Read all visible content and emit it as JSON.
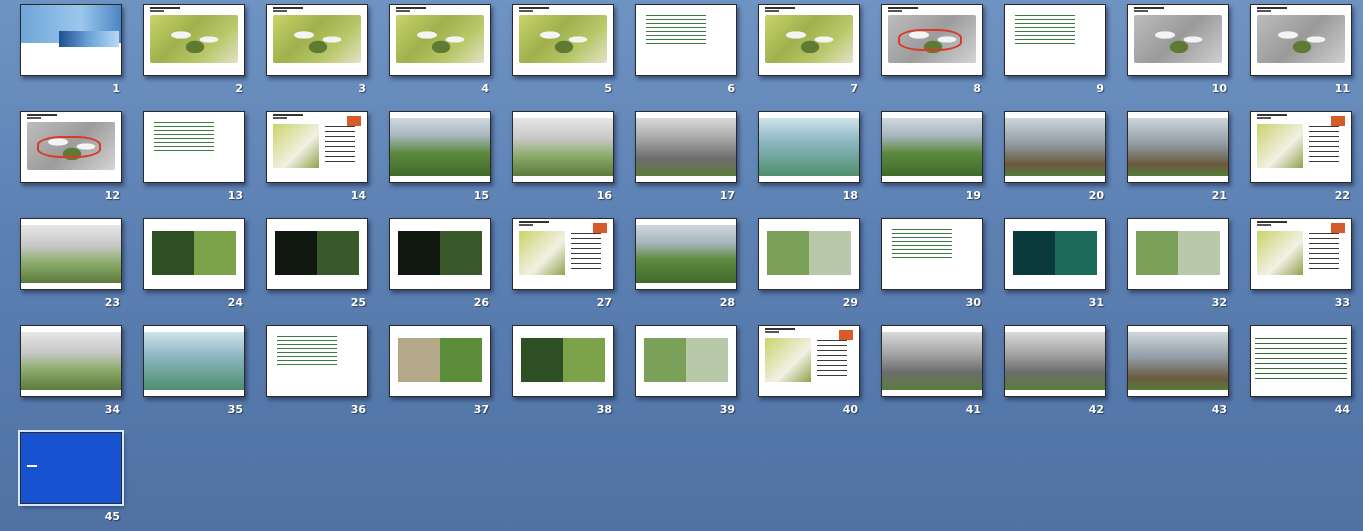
{
  "view": "slide-sorter",
  "slides": [
    {
      "n": "1",
      "kind": "cover"
    },
    {
      "n": "2",
      "kind": "plan"
    },
    {
      "n": "3",
      "kind": "plan"
    },
    {
      "n": "4",
      "kind": "plan"
    },
    {
      "n": "5",
      "kind": "plan"
    },
    {
      "n": "6",
      "kind": "text"
    },
    {
      "n": "7",
      "kind": "plan"
    },
    {
      "n": "8",
      "kind": "plan-red"
    },
    {
      "n": "9",
      "kind": "text"
    },
    {
      "n": "10",
      "kind": "plan-gray"
    },
    {
      "n": "11",
      "kind": "plan-gray"
    },
    {
      "n": "12",
      "kind": "plan-red"
    },
    {
      "n": "13",
      "kind": "text"
    },
    {
      "n": "14",
      "kind": "side"
    },
    {
      "n": "15",
      "kind": "photo"
    },
    {
      "n": "16",
      "kind": "photo-city"
    },
    {
      "n": "17",
      "kind": "photo-street"
    },
    {
      "n": "18",
      "kind": "photo-water"
    },
    {
      "n": "19",
      "kind": "photo"
    },
    {
      "n": "20",
      "kind": "photo-building"
    },
    {
      "n": "21",
      "kind": "photo-building"
    },
    {
      "n": "22",
      "kind": "side"
    },
    {
      "n": "23",
      "kind": "photo-city"
    },
    {
      "n": "24",
      "kind": "split"
    },
    {
      "n": "25",
      "kind": "split-night"
    },
    {
      "n": "26",
      "kind": "split-night"
    },
    {
      "n": "27",
      "kind": "side"
    },
    {
      "n": "28",
      "kind": "photo"
    },
    {
      "n": "29",
      "kind": "split-garden"
    },
    {
      "n": "30",
      "kind": "text"
    },
    {
      "n": "31",
      "kind": "split-aqua"
    },
    {
      "n": "32",
      "kind": "split-garden"
    },
    {
      "n": "33",
      "kind": "side"
    },
    {
      "n": "34",
      "kind": "photo-city"
    },
    {
      "n": "35",
      "kind": "photo-water"
    },
    {
      "n": "36",
      "kind": "text"
    },
    {
      "n": "37",
      "kind": "split-stair"
    },
    {
      "n": "38",
      "kind": "split"
    },
    {
      "n": "39",
      "kind": "split-garden"
    },
    {
      "n": "40",
      "kind": "side"
    },
    {
      "n": "41",
      "kind": "photo-street"
    },
    {
      "n": "42",
      "kind": "photo-street"
    },
    {
      "n": "43",
      "kind": "photo-building"
    },
    {
      "n": "44",
      "kind": "dense"
    },
    {
      "n": "45",
      "kind": "blue"
    }
  ],
  "colors": {
    "background": "#5c80b2",
    "accent_blue": "#1753d0",
    "plan_green": "#9fb04c",
    "markup_red": "#d83a2a"
  }
}
